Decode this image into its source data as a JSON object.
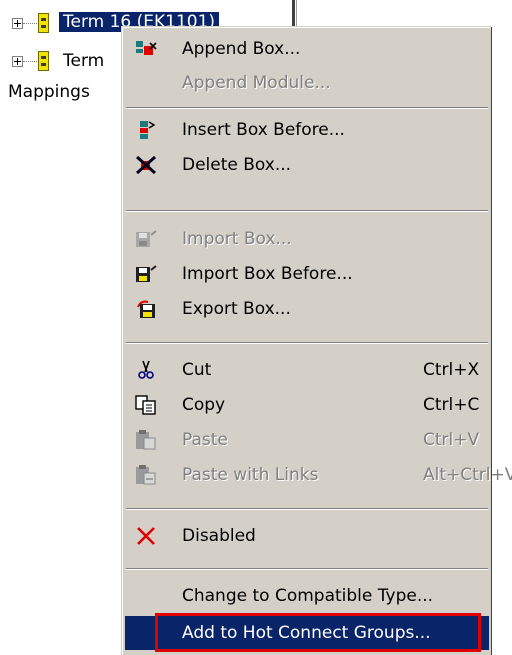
{
  "tree": {
    "row1_label": "Term 16 (EK1101)",
    "row2_label": "Term",
    "mappings_label": "Mappings"
  },
  "menu": {
    "append_box": "Append Box...",
    "append_module": "Append Module...",
    "insert_box_before": "Insert Box Before...",
    "delete_box": "Delete Box...",
    "import_box": "Import Box...",
    "import_box_before": "Import Box Before...",
    "export_box": "Export Box...",
    "cut": "Cut",
    "cut_shortcut": "Ctrl+X",
    "copy": "Copy",
    "copy_shortcut": "Ctrl+C",
    "paste": "Paste",
    "paste_shortcut": "Ctrl+V",
    "paste_links": "Paste with Links",
    "paste_links_shortcut": "Alt+Ctrl+V",
    "disabled": "Disabled",
    "change_type": "Change to Compatible Type...",
    "add_hot_connect": "Add to Hot Connect Groups..."
  },
  "colors": {
    "menu_bg": "#d4d0c8",
    "highlight": "#0a246a",
    "highlight_box": "#e00000",
    "disabled_text": "#808080"
  }
}
